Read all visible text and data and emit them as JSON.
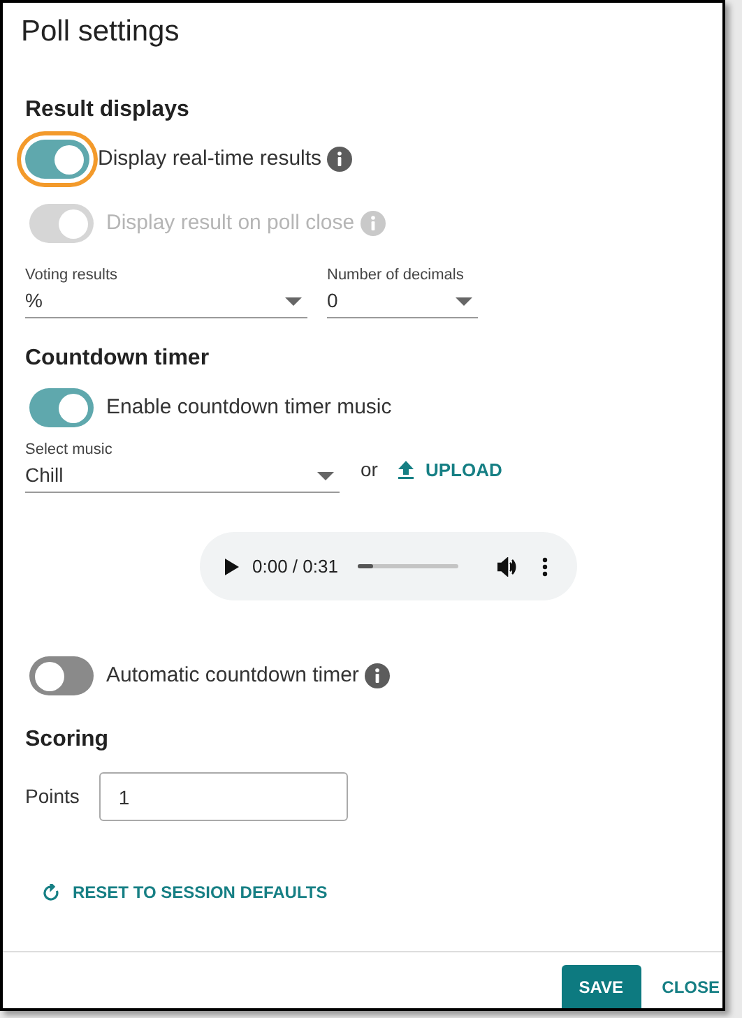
{
  "dialog": {
    "title": "Poll settings"
  },
  "result_displays": {
    "heading": "Result displays",
    "toggles": [
      {
        "label": "Display real-time results",
        "on": true,
        "disabled": false,
        "focused": true,
        "info": true
      },
      {
        "label": "Display result on poll close",
        "on": true,
        "disabled": true,
        "focused": false,
        "info": true
      }
    ],
    "selects": [
      {
        "label": "Voting results",
        "value": "%"
      },
      {
        "label": "Number of decimals",
        "value": "0"
      }
    ]
  },
  "countdown_timer": {
    "heading": "Countdown timer",
    "music_toggle": {
      "label": "Enable countdown timer music",
      "on": true,
      "disabled": false,
      "focused": false,
      "info": false
    },
    "music_select": {
      "label": "Select music",
      "value": "Chill"
    },
    "or_text": "or",
    "upload_button": "UPLOAD",
    "audio_player": {
      "time": "0:00 / 0:31",
      "level": 0.15
    },
    "auto_toggle": {
      "label": "Automatic countdown timer",
      "on": false,
      "disabled": false,
      "focused": false,
      "info": true
    }
  },
  "scoring": {
    "heading": "Scoring",
    "points_label": "Points",
    "points_value": "1"
  },
  "reset_button": "RESET TO SESSION DEFAULTS",
  "footer": {
    "save_button": "SAVE",
    "close_button": "CLOSE"
  }
}
